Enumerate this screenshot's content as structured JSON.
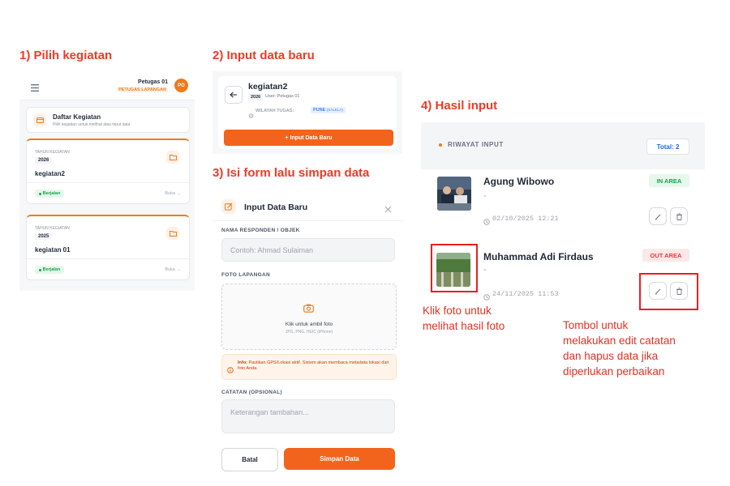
{
  "steps": {
    "s1": "1) Pilih kegiatan",
    "s2": "2) Input data baru",
    "s3": "3) Isi form lalu simpan data",
    "s4": "4) Hasil input"
  },
  "panel1": {
    "user_name": "Petugas 01",
    "user_role": "PETUGAS LAPANGAN",
    "avatar": "PO",
    "list_title": "Daftar Kegiatan",
    "list_subtitle": "Pilih kegiatan untuk melihat atau input data",
    "activities": [
      {
        "year_label": "TAHUN KEGIATAN",
        "year": "2026",
        "name": "kegiatan2",
        "status": "Berjalan",
        "open": "Buka →"
      },
      {
        "year_label": "TAHUN KEGIATAN",
        "year": "2025",
        "name": "kegiatan 01",
        "status": "Berjalan",
        "open": "Buka →"
      }
    ]
  },
  "panel2": {
    "title": "kegiatan2",
    "year": "2026",
    "user": "User: Petugas 01",
    "area_label": "WILAYAH TUGAS:",
    "area_value": "PUNE",
    "area_value_sub": "(SALELA)",
    "button": "+ Input Data Baru"
  },
  "panel3": {
    "title": "Input Data Baru",
    "field1_label": "NAMA RESPONDEN / OBJEK",
    "field1_placeholder": "Contoh: Ahmad Sulaiman",
    "photo_label": "FOTO LAPANGAN",
    "photo_cta": "Klik untuk ambil foto",
    "photo_formats": "JPG, PNG, HEIC (iPhone)",
    "info_bold": "Info:",
    "info_text": "Pastikan GPS/Lokasi aktif. Sistem akan membaca metadata lokasi dari foto Anda.",
    "notes_label": "CATATAN (OPSIONAL)",
    "notes_placeholder": "Keterangan tambahan...",
    "cancel": "Batal",
    "save": "Simpan Data"
  },
  "panel4": {
    "header": "RIWAYAT INPUT",
    "total": "Total: 2",
    "entries": [
      {
        "name": "Agung Wibowo",
        "dash": "-",
        "datetime": "02/10/2025 12:21",
        "status": "IN AREA"
      },
      {
        "name": "Muhammad Adi Firdaus",
        "dash": "-",
        "datetime": "24/11/2025 11:53",
        "status": "OUT AREA"
      }
    ]
  },
  "notes": {
    "photo": [
      "Klik foto untuk",
      "melihat hasil foto"
    ],
    "buttons": [
      "Tombol untuk",
      "melakukan edit catatan",
      "dan hapus data jika",
      "diperlukan perbaikan"
    ]
  }
}
